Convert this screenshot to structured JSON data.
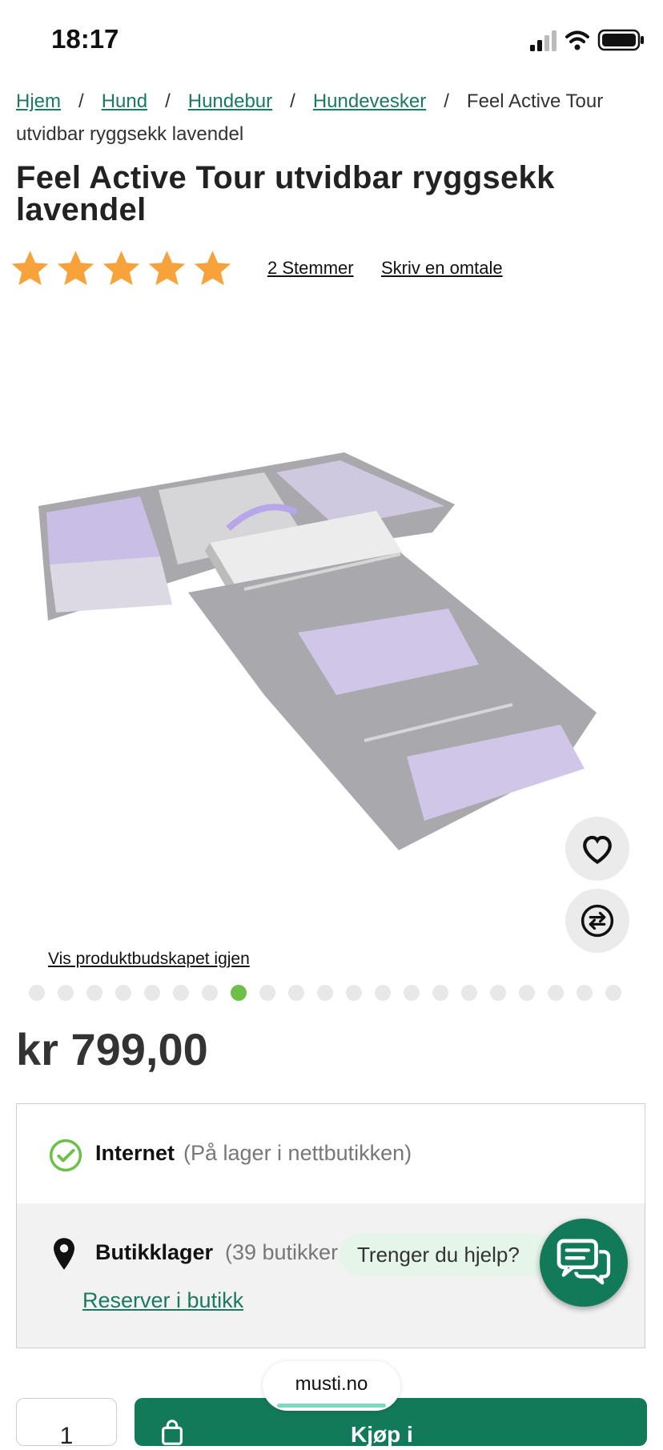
{
  "status_bar": {
    "time": "18:17"
  },
  "breadcrumb": {
    "items": [
      "Hjem",
      "Hund",
      "Hundebur",
      "Hundevesker"
    ],
    "separator": "/",
    "current": "Feel Active Tour utvidbar ryggsekk lavendel"
  },
  "product": {
    "title": "Feel Active Tour utvidbar ryggsekk lavendel",
    "rating": {
      "stars": 5,
      "max": 5,
      "votes_label": "2 Stemmer",
      "review_label": "Skriv en omtale"
    },
    "image_alt": "Feel Active Tour utvidbar ryggsekk lavendel",
    "show_message_label": "Vis produktbudskapet igjen",
    "carousel": {
      "total": 21,
      "active_index": 7
    },
    "price": "kr 799,00"
  },
  "stock": {
    "online_label": "Internet",
    "online_note": "(På lager i nettbutikken)",
    "store_label": "Butikklager",
    "store_note": "(39 butikker",
    "reserve_label": "Reserver i butikk"
  },
  "help": {
    "bubble_text": "Trenger du hjelp?"
  },
  "purchase": {
    "quantity": "1",
    "buy_label": "Kjøp i"
  },
  "browser": {
    "url": "musti.no"
  },
  "colors": {
    "brand_green": "#137a59",
    "link_green": "#1a7a5e",
    "star": "#f7a23b",
    "active_dot": "#6cc04a"
  }
}
